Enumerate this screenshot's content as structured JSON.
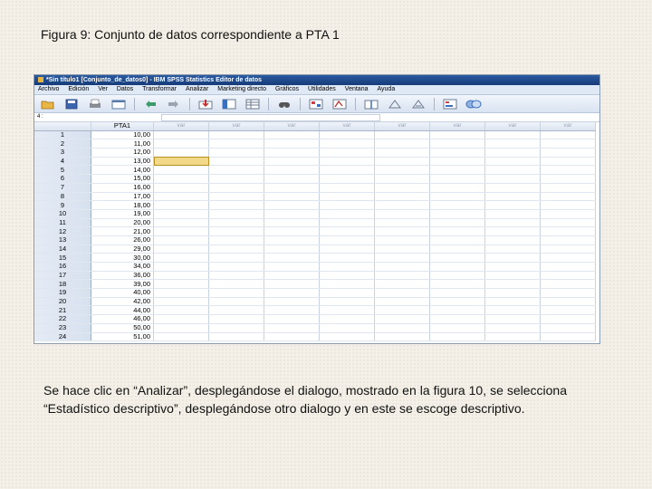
{
  "caption": "Figura 9: Conjunto de datos correspondiente a PTA 1",
  "window": {
    "title": "*Sin título1 [Conjunto_de_datos0] - IBM SPSS Statistics Editor de datos"
  },
  "menu": [
    "Archivo",
    "Edición",
    "Ver",
    "Datos",
    "Transformar",
    "Analizar",
    "Marketing directo",
    "Gráficos",
    "Utilidades",
    "Ventana",
    "Ayuda"
  ],
  "toolbar_icons": [
    "open-icon",
    "save-icon",
    "print-icon",
    "dialog-recall-icon",
    "undo-icon",
    "redo-icon",
    "goto-case-icon",
    "goto-variable-icon",
    "variables-icon",
    "find-icon",
    "insert-cases-icon",
    "insert-variable-icon",
    "split-file-icon",
    "weight-cases-icon",
    "select-cases-icon",
    "value-labels-icon",
    "use-sets-icon"
  ],
  "cell_editor": {
    "ref": "4 :"
  },
  "grid": {
    "var_header": "PTA1",
    "empty_header": "var",
    "rows": [
      {
        "n": "1",
        "v": "10,00"
      },
      {
        "n": "2",
        "v": "11,00"
      },
      {
        "n": "3",
        "v": "12,00"
      },
      {
        "n": "4",
        "v": "13,00"
      },
      {
        "n": "5",
        "v": "14,00"
      },
      {
        "n": "6",
        "v": "15,00"
      },
      {
        "n": "7",
        "v": "16,00"
      },
      {
        "n": "8",
        "v": "17,00"
      },
      {
        "n": "9",
        "v": "18,00"
      },
      {
        "n": "10",
        "v": "19,00"
      },
      {
        "n": "11",
        "v": "20,00"
      },
      {
        "n": "12",
        "v": "21,00"
      },
      {
        "n": "13",
        "v": "26,00"
      },
      {
        "n": "14",
        "v": "29,00"
      },
      {
        "n": "15",
        "v": "30,00"
      },
      {
        "n": "16",
        "v": "34,00"
      },
      {
        "n": "17",
        "v": "36,00"
      },
      {
        "n": "18",
        "v": "39,00"
      },
      {
        "n": "19",
        "v": "40,00"
      },
      {
        "n": "20",
        "v": "42,00"
      },
      {
        "n": "21",
        "v": "44,00"
      },
      {
        "n": "22",
        "v": "46,00"
      },
      {
        "n": "23",
        "v": "50,00"
      },
      {
        "n": "24",
        "v": "51,00"
      }
    ],
    "selected_row": 4
  },
  "paragraph": "Se hace clic en “Analizar”, desplegándose el dialogo, mostrado en la figura 10, se selecciona “Estadístico descriptivo”, desplegándose otro dialogo y en este se escoge descriptivo."
}
